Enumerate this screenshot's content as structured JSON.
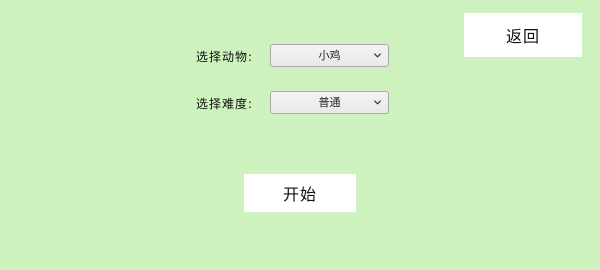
{
  "header": {
    "back_label": "返回"
  },
  "form": {
    "animal": {
      "label": "选择动物:",
      "selected": "小鸡"
    },
    "difficulty": {
      "label": "选择难度:",
      "selected": "普通"
    }
  },
  "actions": {
    "start_label": "开始"
  },
  "colors": {
    "background": "#cdf2bd",
    "button_background": "#ffffff"
  },
  "icons": {
    "dropdown": "chevron-down-icon"
  }
}
